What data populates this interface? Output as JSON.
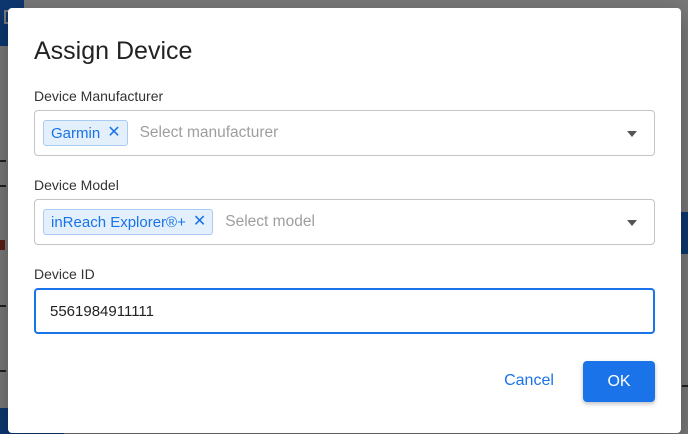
{
  "dialog": {
    "title": "Assign Device",
    "manufacturer": {
      "label": "Device Manufacturer",
      "selected_chip": "Garmin",
      "chip_remove_glyph": "✕",
      "placeholder": "Select manufacturer",
      "icon": "chevron-down-icon"
    },
    "model": {
      "label": "Device Model",
      "selected_chip": "inReach Explorer®+",
      "chip_remove_glyph": "✕",
      "placeholder": "Select model",
      "icon": "chevron-down-icon"
    },
    "device_id": {
      "label": "Device ID",
      "value": "5561984911111"
    },
    "buttons": {
      "cancel": "Cancel",
      "ok": "OK"
    }
  },
  "colors": {
    "accent": "#1a73e8",
    "chip_bg": "#e3f0fc",
    "overlay": "rgba(0,0,0,0.52)"
  }
}
